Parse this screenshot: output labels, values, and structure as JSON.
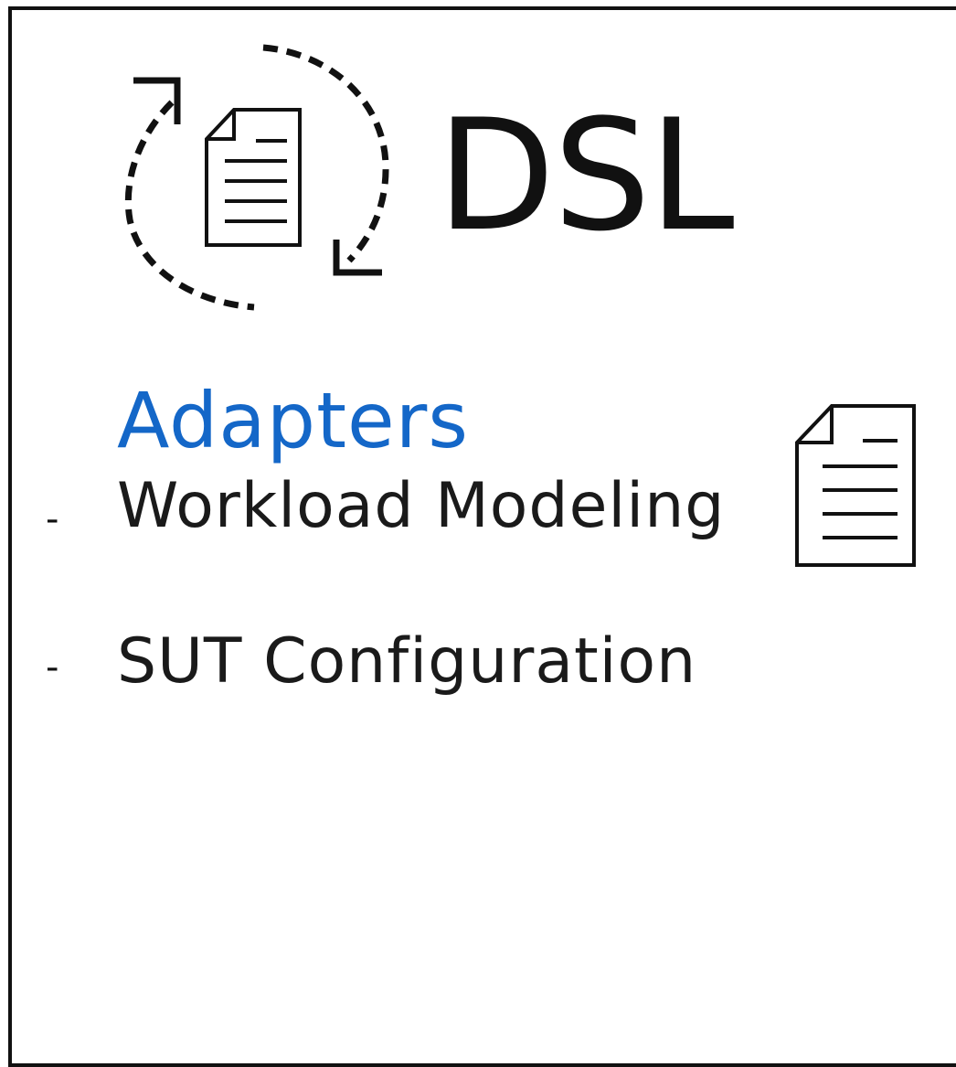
{
  "title": "DSL",
  "section": {
    "heading": "Adapters",
    "items": [
      {
        "bullet": "-",
        "label": "Workload  Modeling"
      },
      {
        "bullet": "-",
        "label": "SUT Configuration"
      }
    ]
  },
  "colors": {
    "heading": "#1467c8",
    "text": "#1a1a1a",
    "border": "#111111"
  },
  "icons": {
    "title_icon": "document-cycle-icon",
    "item_icon": "document-icon"
  }
}
